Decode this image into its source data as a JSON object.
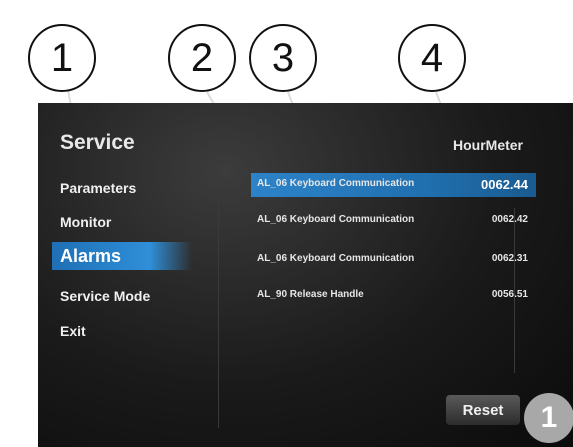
{
  "callouts": [
    "1",
    "2",
    "3",
    "4"
  ],
  "screen": {
    "title": "Service",
    "column_header": "HourMeter",
    "menu": [
      "Parameters",
      "Monitor",
      "Alarms",
      "Service Mode",
      "Exit"
    ],
    "active_menu": "Alarms",
    "alarms": [
      {
        "code": "AL_06 Keyboard Communication",
        "hours": "0062.44",
        "selected": true
      },
      {
        "code": "AL_06 Keyboard Communication",
        "hours": "0062.42",
        "selected": false
      },
      {
        "code": "AL_06 Keyboard Communication",
        "hours": "0062.31",
        "selected": false
      },
      {
        "code": "AL_90 Release Handle",
        "hours": "0056.51",
        "selected": false
      }
    ],
    "reset_label": "Reset",
    "badge": "1"
  },
  "colors": {
    "highlight": "#2f8fd8",
    "background": "#1a1a1a"
  }
}
